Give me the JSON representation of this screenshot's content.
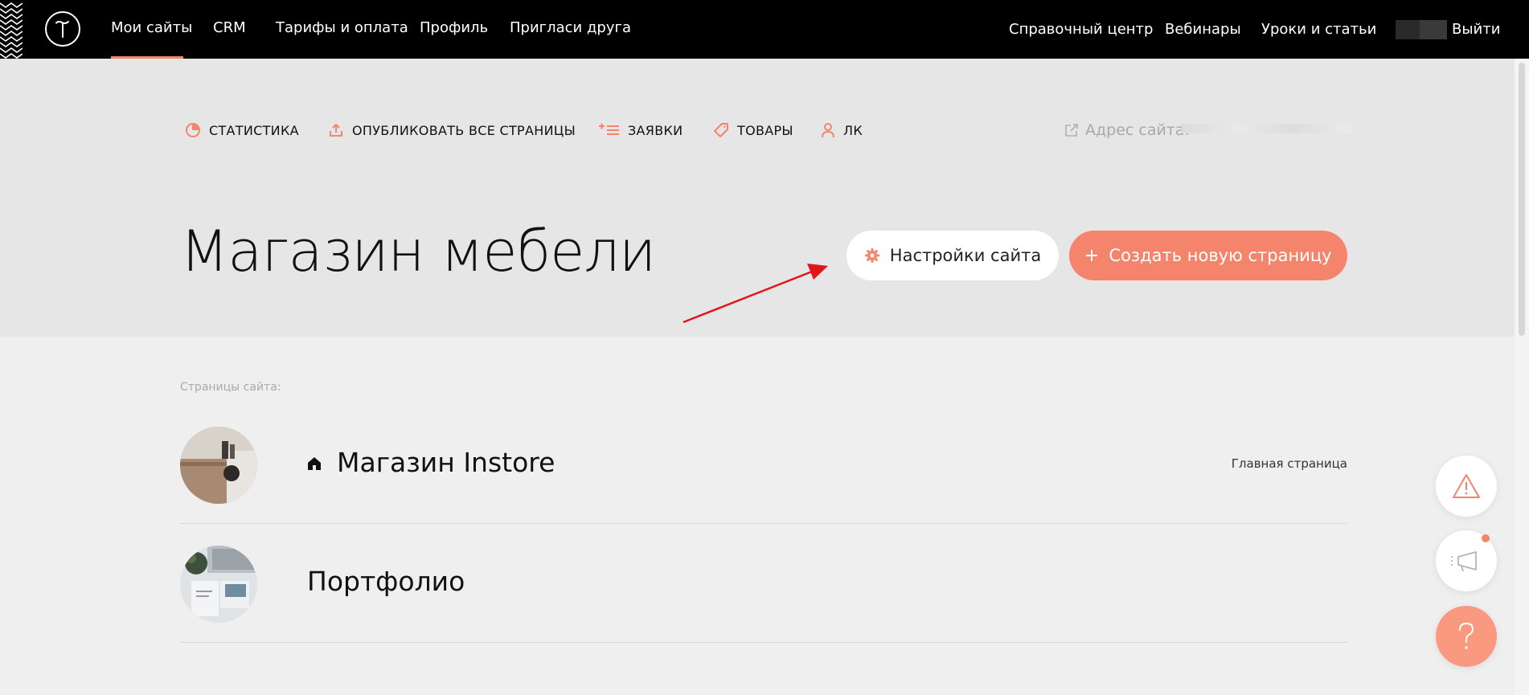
{
  "topnav": {
    "left": [
      {
        "label": "Мои сайты",
        "active": true
      },
      {
        "label": "CRM"
      },
      {
        "label": "Тарифы и оплата"
      },
      {
        "label": "Профиль"
      },
      {
        "label": "Пригласи друга"
      }
    ],
    "right": [
      {
        "label": "Справочный центр"
      },
      {
        "label": "Вебинары"
      },
      {
        "label": "Уроки и статьи"
      }
    ],
    "logout": "Выйти"
  },
  "toolbar": {
    "stats": "СТАТИСТИКА",
    "publish_all": "ОПУБЛИКОВАТЬ ВСЕ СТРАНИЦЫ",
    "leads": "ЗАЯВКИ",
    "products": "ТОВАРЫ",
    "account": "ЛК",
    "site_address_label": "Адрес сайта:"
  },
  "site": {
    "title": "Магазин мебели",
    "settings_button": "Настройки сайта",
    "create_page_button": "Создать новую страницу"
  },
  "pages": {
    "caption": "Страницы сайта:",
    "items": [
      {
        "name": "Магазин Instore",
        "is_home": true,
        "badge": "Главная страница"
      },
      {
        "name": "Портфолио",
        "is_home": false
      }
    ]
  },
  "colors": {
    "accent": "#f4846b",
    "topbar": "#000000",
    "header_bg": "#e6e6e6",
    "page_bg": "#efefef",
    "annotation_arrow": "#e0161f"
  },
  "icons": {
    "stats": "pie-chart-icon",
    "publish": "upload-icon",
    "leads": "list-plus-icon",
    "products": "tag-icon",
    "account": "person-icon",
    "address": "external-link-icon",
    "settings": "gear-icon",
    "create": "plus-icon",
    "home": "home-icon",
    "report": "warning-icon",
    "news": "megaphone-icon",
    "help": "question-icon"
  }
}
